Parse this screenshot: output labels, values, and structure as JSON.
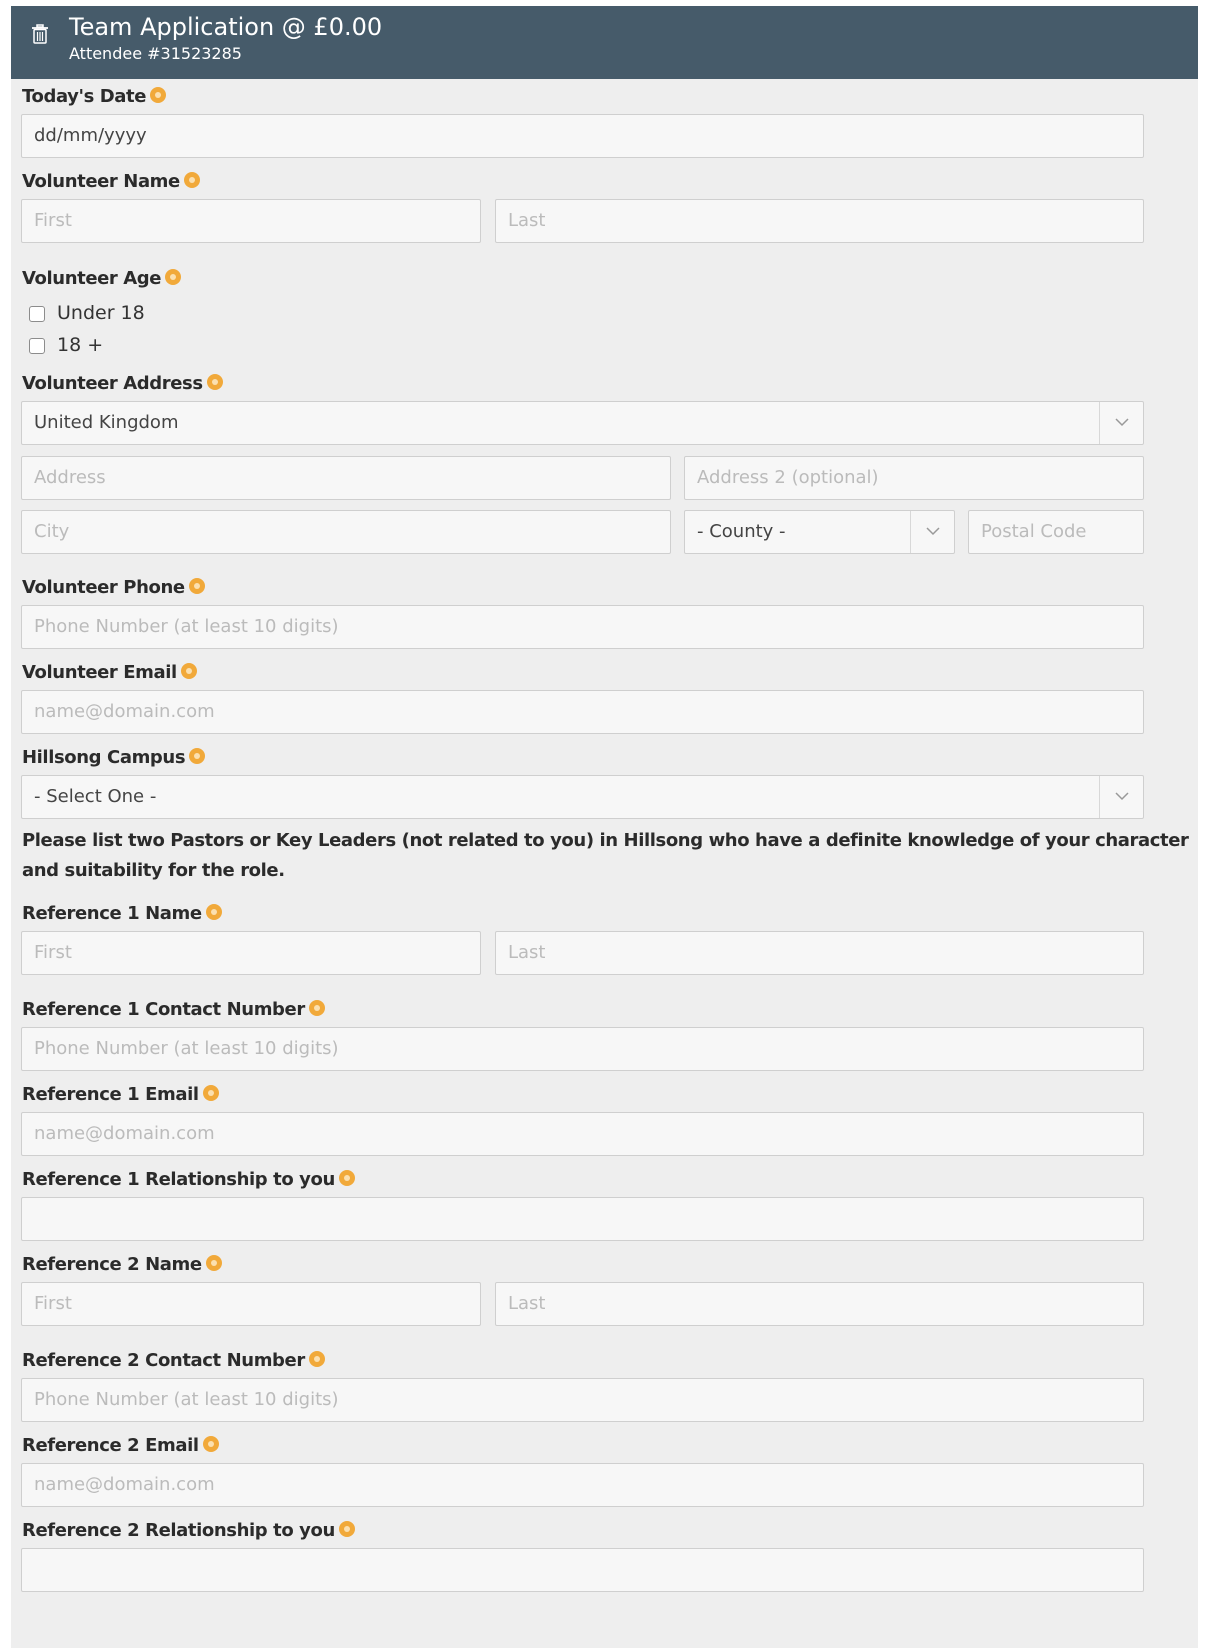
{
  "header": {
    "title": "Team Application @ £0.00",
    "subtitle": "Attendee #31523285",
    "icon": "trash-icon"
  },
  "fields": {
    "todays_date": {
      "label": "Today's Date",
      "placeholder": "dd/mm/yyyy"
    },
    "volunteer_name": {
      "label": "Volunteer Name",
      "first_placeholder": "First",
      "last_placeholder": "Last"
    },
    "volunteer_age": {
      "label": "Volunteer Age",
      "options": [
        "Under 18",
        "18 +"
      ]
    },
    "volunteer_address": {
      "label": "Volunteer Address",
      "country": "United Kingdom",
      "address_placeholder": "Address",
      "address2_placeholder": "Address 2 (optional)",
      "city_placeholder": "City",
      "county": "- County -",
      "postal_placeholder": "Postal Code"
    },
    "volunteer_phone": {
      "label": "Volunteer Phone",
      "placeholder": "Phone Number (at least 10 digits)"
    },
    "volunteer_email": {
      "label": "Volunteer Email",
      "placeholder": "name@domain.com"
    },
    "hillsong_campus": {
      "label": "Hillsong Campus",
      "value": "- Select One -"
    },
    "references_note": "Please list two Pastors or Key Leaders (not related to you) in Hillsong who have a definite knowledge of your character and suitability for the role.",
    "ref1_name": {
      "label": "Reference 1 Name",
      "first_placeholder": "First",
      "last_placeholder": "Last"
    },
    "ref1_contact": {
      "label": "Reference 1 Contact Number",
      "placeholder": "Phone Number (at least 10 digits)"
    },
    "ref1_email": {
      "label": "Reference 1 Email",
      "placeholder": "name@domain.com"
    },
    "ref1_relationship": {
      "label": "Reference 1 Relationship to you"
    },
    "ref2_name": {
      "label": "Reference 2 Name",
      "first_placeholder": "First",
      "last_placeholder": "Last"
    },
    "ref2_contact": {
      "label": "Reference 2 Contact Number",
      "placeholder": "Phone Number (at least 10 digits)"
    },
    "ref2_email": {
      "label": "Reference 2 Email",
      "placeholder": "name@domain.com"
    },
    "ref2_relationship": {
      "label": "Reference 2 Relationship to you"
    }
  },
  "colors": {
    "header_bg": "#465b6a",
    "panel_bg": "#eeeeee",
    "required_marker": "#f1a93a",
    "input_bg": "#f7f7f7",
    "input_border": "#cfcfcf"
  }
}
